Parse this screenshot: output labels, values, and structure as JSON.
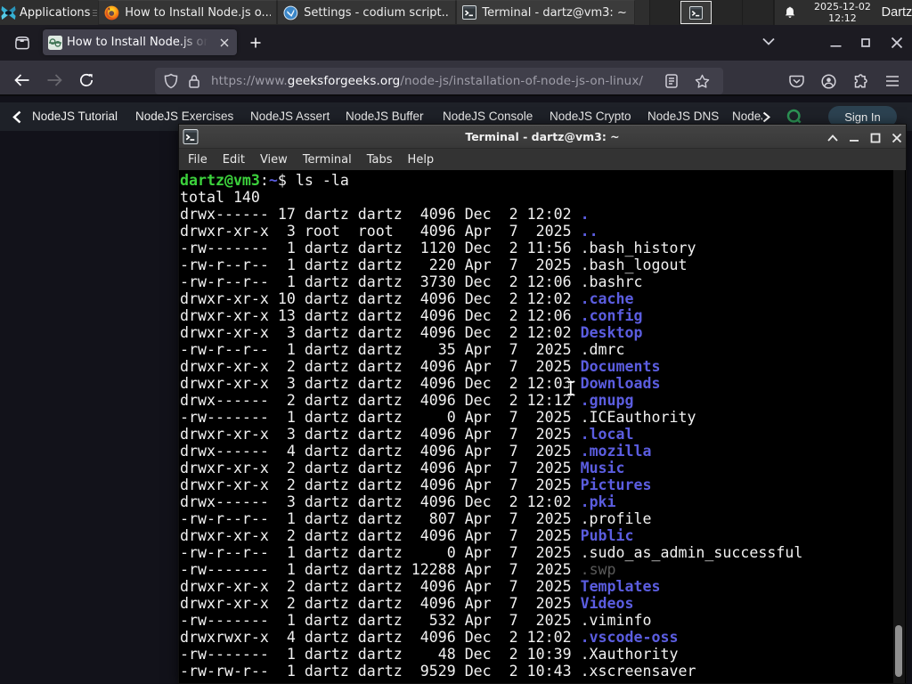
{
  "panel": {
    "applications_label": "Applications",
    "tasks": [
      {
        "title": "How to Install Node.js o...",
        "icon": "firefox"
      },
      {
        "title": "Settings - codium script...",
        "icon": "codium"
      },
      {
        "title": "Terminal - dartz@vm3: ~",
        "icon": "terminal"
      }
    ],
    "clock": {
      "date": "2025-12-02",
      "time": "12:12"
    },
    "user": "Dartz"
  },
  "browser": {
    "tab_title": "How to Install Node.js on",
    "url_scheme": "https://www.",
    "url_domain": "geeksforgeeks.org",
    "url_path": "/node-js/installation-of-node-js-on-linux/"
  },
  "page": {
    "nav_links": [
      "NodeJS Tutorial",
      "NodeJS Exercises",
      "NodeJS Assert",
      "NodeJS Buffer",
      "NodeJS Console",
      "NodeJS Crypto",
      "NodeJS DNS",
      "NodeJS"
    ],
    "signin_label": "Sign In"
  },
  "colors": {
    "term_green": "#3cd23c",
    "term_blue": "#5b5de0",
    "term_dim": "#5a5a5a",
    "term_fg": "#f1f1f1",
    "gfg_green": "#2d9455",
    "signin_bg": "#2c4251"
  },
  "terminal": {
    "title": "Terminal - dartz@vm3: ~",
    "menus": [
      "File",
      "Edit",
      "View",
      "Terminal",
      "Tabs",
      "Help"
    ],
    "lines": [
      [
        [
          "user",
          "dartz@vm3"
        ],
        [
          "plain",
          ":"
        ],
        [
          "tilde",
          "~"
        ],
        [
          "plain",
          "$ ls -la"
        ]
      ],
      [
        [
          "plain",
          "total 140"
        ]
      ],
      [
        [
          "plain",
          "drwx------ 17 dartz dartz  4096 Dec  2 12:02 "
        ],
        [
          "dir",
          "."
        ]
      ],
      [
        [
          "plain",
          "drwxr-xr-x  3 root  root   4096 Apr  7  2025 "
        ],
        [
          "dir",
          ".."
        ]
      ],
      [
        [
          "plain",
          "-rw-------  1 dartz dartz  1120 Dec  2 11:56 .bash_history"
        ]
      ],
      [
        [
          "plain",
          "-rw-r--r--  1 dartz dartz   220 Apr  7  2025 .bash_logout"
        ]
      ],
      [
        [
          "plain",
          "-rw-r--r--  1 dartz dartz  3730 Dec  2 12:06 .bashrc"
        ]
      ],
      [
        [
          "plain",
          "drwxr-xr-x 10 dartz dartz  4096 Dec  2 12:02 "
        ],
        [
          "dir",
          ".cache"
        ]
      ],
      [
        [
          "plain",
          "drwxr-xr-x 13 dartz dartz  4096 Dec  2 12:06 "
        ],
        [
          "dir",
          ".config"
        ]
      ],
      [
        [
          "plain",
          "drwxr-xr-x  3 dartz dartz  4096 Dec  2 12:02 "
        ],
        [
          "dir",
          "Desktop"
        ]
      ],
      [
        [
          "plain",
          "-rw-r--r--  1 dartz dartz    35 Apr  7  2025 .dmrc"
        ]
      ],
      [
        [
          "plain",
          "drwxr-xr-x  2 dartz dartz  4096 Apr  7  2025 "
        ],
        [
          "dir",
          "Documents"
        ]
      ],
      [
        [
          "plain",
          "drwxr-xr-x  3 dartz dartz  4096 Dec  2 12:03 "
        ],
        [
          "dir",
          "Downloads"
        ]
      ],
      [
        [
          "plain",
          "drwx------  2 dartz dartz  4096 Dec  2 12:12 "
        ],
        [
          "dir",
          ".gnupg"
        ]
      ],
      [
        [
          "plain",
          "-rw-------  1 dartz dartz     0 Apr  7  2025 .ICEauthority"
        ]
      ],
      [
        [
          "plain",
          "drwxr-xr-x  3 dartz dartz  4096 Apr  7  2025 "
        ],
        [
          "dir",
          ".local"
        ]
      ],
      [
        [
          "plain",
          "drwx------  4 dartz dartz  4096 Apr  7  2025 "
        ],
        [
          "dir",
          ".mozilla"
        ]
      ],
      [
        [
          "plain",
          "drwxr-xr-x  2 dartz dartz  4096 Apr  7  2025 "
        ],
        [
          "dir",
          "Music"
        ]
      ],
      [
        [
          "plain",
          "drwxr-xr-x  2 dartz dartz  4096 Apr  7  2025 "
        ],
        [
          "dir",
          "Pictures"
        ]
      ],
      [
        [
          "plain",
          "drwx------  3 dartz dartz  4096 Dec  2 12:02 "
        ],
        [
          "dir",
          ".pki"
        ]
      ],
      [
        [
          "plain",
          "-rw-r--r--  1 dartz dartz   807 Apr  7  2025 .profile"
        ]
      ],
      [
        [
          "plain",
          "drwxr-xr-x  2 dartz dartz  4096 Apr  7  2025 "
        ],
        [
          "dir",
          "Public"
        ]
      ],
      [
        [
          "plain",
          "-rw-r--r--  1 dartz dartz     0 Apr  7  2025 .sudo_as_admin_successful"
        ]
      ],
      [
        [
          "plain",
          "-rw-------  1 dartz dartz 12288 Apr  7  2025 "
        ],
        [
          "dim",
          ".swp"
        ]
      ],
      [
        [
          "plain",
          "drwxr-xr-x  2 dartz dartz  4096 Apr  7  2025 "
        ],
        [
          "dir",
          "Templates"
        ]
      ],
      [
        [
          "plain",
          "drwxr-xr-x  2 dartz dartz  4096 Apr  7  2025 "
        ],
        [
          "dir",
          "Videos"
        ]
      ],
      [
        [
          "plain",
          "-rw-------  1 dartz dartz   532 Apr  7  2025 .viminfo"
        ]
      ],
      [
        [
          "plain",
          "drwxrwxr-x  4 dartz dartz  4096 Dec  2 12:02 "
        ],
        [
          "dir",
          ".vscode-oss"
        ]
      ],
      [
        [
          "plain",
          "-rw-------  1 dartz dartz    48 Dec  2 10:39 .Xauthority"
        ]
      ],
      [
        [
          "plain",
          "-rw-rw-r--  1 dartz dartz  9529 Dec  2 10:43 .xscreensaver"
        ]
      ]
    ]
  }
}
